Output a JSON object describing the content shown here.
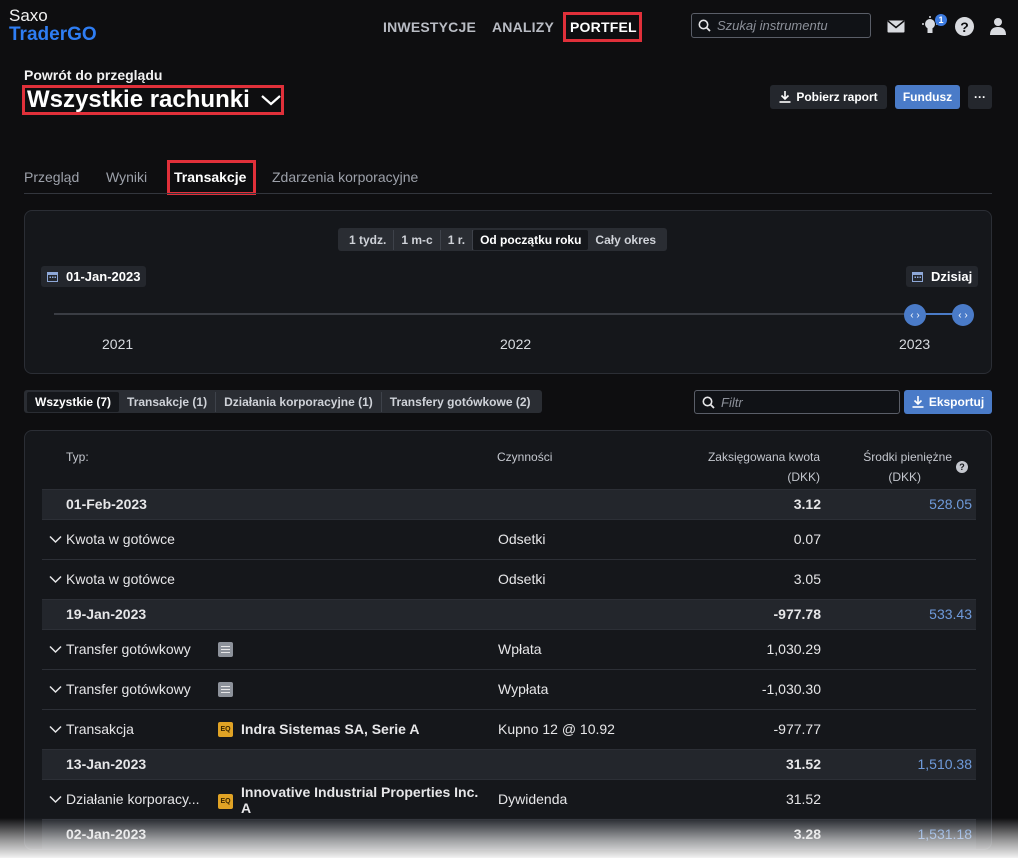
{
  "brand": {
    "line1": "Saxo",
    "line2": "TraderGO"
  },
  "nav": {
    "items": [
      "INWESTYCJE",
      "ANALIZY",
      "PORTFEL"
    ],
    "active": "PORTFEL"
  },
  "search": {
    "placeholder": "Szukaj instrumentu"
  },
  "notifications": {
    "count": "1"
  },
  "header": {
    "back_label": "Powrót do przeglądu",
    "title": "Wszystkie rachunki",
    "report_button": "Pobierz raport",
    "fund_button": "Fundusz",
    "more_button": "···"
  },
  "tabs": [
    "Przegląd",
    "Wyniki",
    "Transakcje",
    "Zdarzenia korporacyjne"
  ],
  "active_tab": "Transakcje",
  "period": {
    "options": [
      "1 tydz.",
      "1 m-c",
      "1 r.",
      "Od początku roku",
      "Cały okres"
    ],
    "active": "Od początku roku",
    "start_date": "01-Jan-2023",
    "end_date": "Dzisiaj",
    "years": [
      "2021",
      "2022",
      "2023"
    ],
    "knob_glyph": "‹ ›"
  },
  "filters": {
    "options": [
      "Wszystkie (7)",
      "Transakcje (1)",
      "Działania korporacyjne (1)",
      "Transfery gotówkowe (2)"
    ],
    "active": "Wszystkie (7)",
    "filter_placeholder": "Filtr",
    "export_button": "Eksportuj"
  },
  "table": {
    "headers": {
      "type": "Typ:",
      "activity": "Czynności",
      "amount_1": "Zaksięgowana kwota",
      "amount_2": "(DKK)",
      "cash_1": "Środki pieniężne",
      "cash_2": "(DKK)"
    },
    "help_glyph": "?",
    "instrument_badge": "EQ",
    "rows": [
      {
        "kind": "group",
        "date": "01-Feb-2023",
        "amount": "3.12",
        "cash": "528.05"
      },
      {
        "kind": "item",
        "type": "Kwota w gotówce",
        "icon": "",
        "instrument": "",
        "activity": "Odsetki",
        "amount": "0.07"
      },
      {
        "kind": "item",
        "type": "Kwota w gotówce",
        "icon": "",
        "instrument": "",
        "activity": "Odsetki",
        "amount": "3.05"
      },
      {
        "kind": "group",
        "date": "19-Jan-2023",
        "amount": "-977.78",
        "cash": "533.43"
      },
      {
        "kind": "item",
        "type": "Transfer gotówkowy",
        "icon": "doc",
        "instrument": "",
        "activity": "Wpłata",
        "amount": "1,030.29"
      },
      {
        "kind": "item",
        "type": "Transfer gotówkowy",
        "icon": "doc",
        "instrument": "",
        "activity": "Wypłata",
        "amount": "-1,030.30"
      },
      {
        "kind": "item",
        "type": "Transakcja",
        "icon": "eq",
        "instrument": "Indra Sistemas SA, Serie A",
        "activity": "Kupno 12 @ 10.92",
        "amount": "-977.77"
      },
      {
        "kind": "group",
        "date": "13-Jan-2023",
        "amount": "31.52",
        "cash": "1,510.38"
      },
      {
        "kind": "item",
        "type": "Działanie korporacy...",
        "icon": "eq",
        "instrument": "Innovative Industrial Properties Inc. A",
        "activity": "Dywidenda",
        "amount": "31.52"
      },
      {
        "kind": "group",
        "date": "02-Jan-2023",
        "amount": "3.28",
        "cash": "1,531.18"
      }
    ]
  },
  "colors": {
    "background": "#0e0e10",
    "accent_blue": "#4a7bc8",
    "brand_blue": "#2e7df3",
    "highlight_red": "#e0303a",
    "cash_blue": "#6f9bdc",
    "equity_badge": "#e0a325"
  }
}
